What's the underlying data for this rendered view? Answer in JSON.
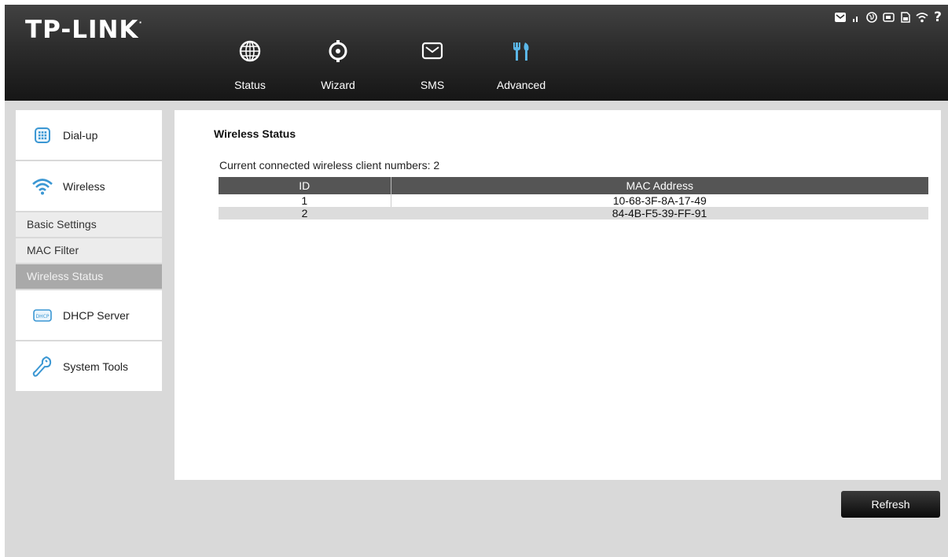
{
  "brand": {
    "name": "TP-LINK",
    "mark": "·"
  },
  "nav": [
    {
      "label": "Status",
      "icon": "globe-icon"
    },
    {
      "label": "Wizard",
      "icon": "wizard-icon"
    },
    {
      "label": "SMS",
      "icon": "envelope-icon"
    },
    {
      "label": "Advanced",
      "icon": "tools-icon",
      "active": true
    }
  ],
  "status_bar": {
    "icons": [
      "message-icon",
      "signal-icon",
      "internet-icon",
      "battery-icon",
      "sim-icon",
      "wifi-icon",
      "help-icon"
    ],
    "help_glyph": "?"
  },
  "sidebar": {
    "items": [
      {
        "label": "Dial-up",
        "icon": "dialup-icon"
      },
      {
        "label": "Wireless",
        "icon": "wifi-icon"
      },
      {
        "label": "Basic Settings"
      },
      {
        "label": "MAC Filter"
      },
      {
        "label": "Wireless Status",
        "active": true
      },
      {
        "label": "DHCP Server",
        "icon": "dhcp-icon",
        "icon_text": "DHCP"
      },
      {
        "label": "System Tools",
        "icon": "wrench-icon"
      }
    ]
  },
  "content": {
    "title": "Wireless Status",
    "clients_text": "Current connected wireless client numbers: 2",
    "table": {
      "columns": [
        "ID",
        "MAC Address"
      ],
      "rows": [
        [
          "1",
          "10-68-3F-8A-17-49"
        ],
        [
          "2",
          "84-4B-F5-39-FF-91"
        ]
      ]
    }
  },
  "actions": {
    "refresh_label": "Refresh"
  },
  "colors": {
    "header": "#2c2c2c",
    "accent_active": "#5bb7e8",
    "background": "#d9d9d9"
  }
}
